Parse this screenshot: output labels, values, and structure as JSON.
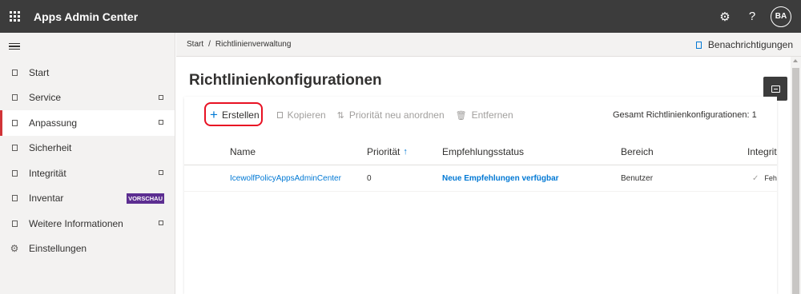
{
  "header": {
    "app_title": "Apps Admin Center",
    "settings_icon": "⚙",
    "help_icon": "?",
    "avatar_initials": "BA"
  },
  "nav": {
    "items": [
      {
        "label": "Start",
        "icon": "square-icon"
      },
      {
        "label": "Service",
        "icon": "square-icon",
        "chevron": true
      },
      {
        "label": "Anpassung",
        "icon": "square-icon",
        "chevron": true,
        "active": true
      },
      {
        "label": "Sicherheit",
        "icon": "square-icon"
      },
      {
        "label": "Integrität",
        "icon": "square-icon",
        "chevron": true
      },
      {
        "label": "Inventar",
        "icon": "square-icon",
        "badge": "VORSCHAU"
      },
      {
        "label": "Weitere Informationen",
        "icon": "square-icon",
        "chevron": true
      },
      {
        "label": "Einstellungen",
        "icon": "gear-icon"
      }
    ]
  },
  "breadcrumb": {
    "home": "Start",
    "separator": "/",
    "current": "Richtlinienverwaltung"
  },
  "notifications": {
    "label": "Benachrichtigungen"
  },
  "page": {
    "title": "Richtlinienkonfigurationen"
  },
  "commands": {
    "create": "Erstellen",
    "copy": "Kopieren",
    "reorder": "Priorität neu anordnen",
    "remove": "Entfernen",
    "total": "Gesamt Richtlinienkonfigurationen: 1"
  },
  "table": {
    "columns": {
      "name": "Name",
      "priority": "Priorität",
      "status": "Empfehlungsstatus",
      "scope": "Bereich",
      "health": "Integritäts"
    },
    "rows": [
      {
        "name": "IcewolfPolicyAppsAdminCenter",
        "priority": "0",
        "status": "Neue Empfehlungen verfügbar",
        "scope": "Benutzer",
        "health": "Fehlerf"
      }
    ]
  },
  "colors": {
    "accent": "#0078d4",
    "topbar": "#3c3c3c",
    "active_indicator": "#d13438",
    "highlight_ring": "#e81123",
    "preview_badge": "#5c2e91"
  }
}
